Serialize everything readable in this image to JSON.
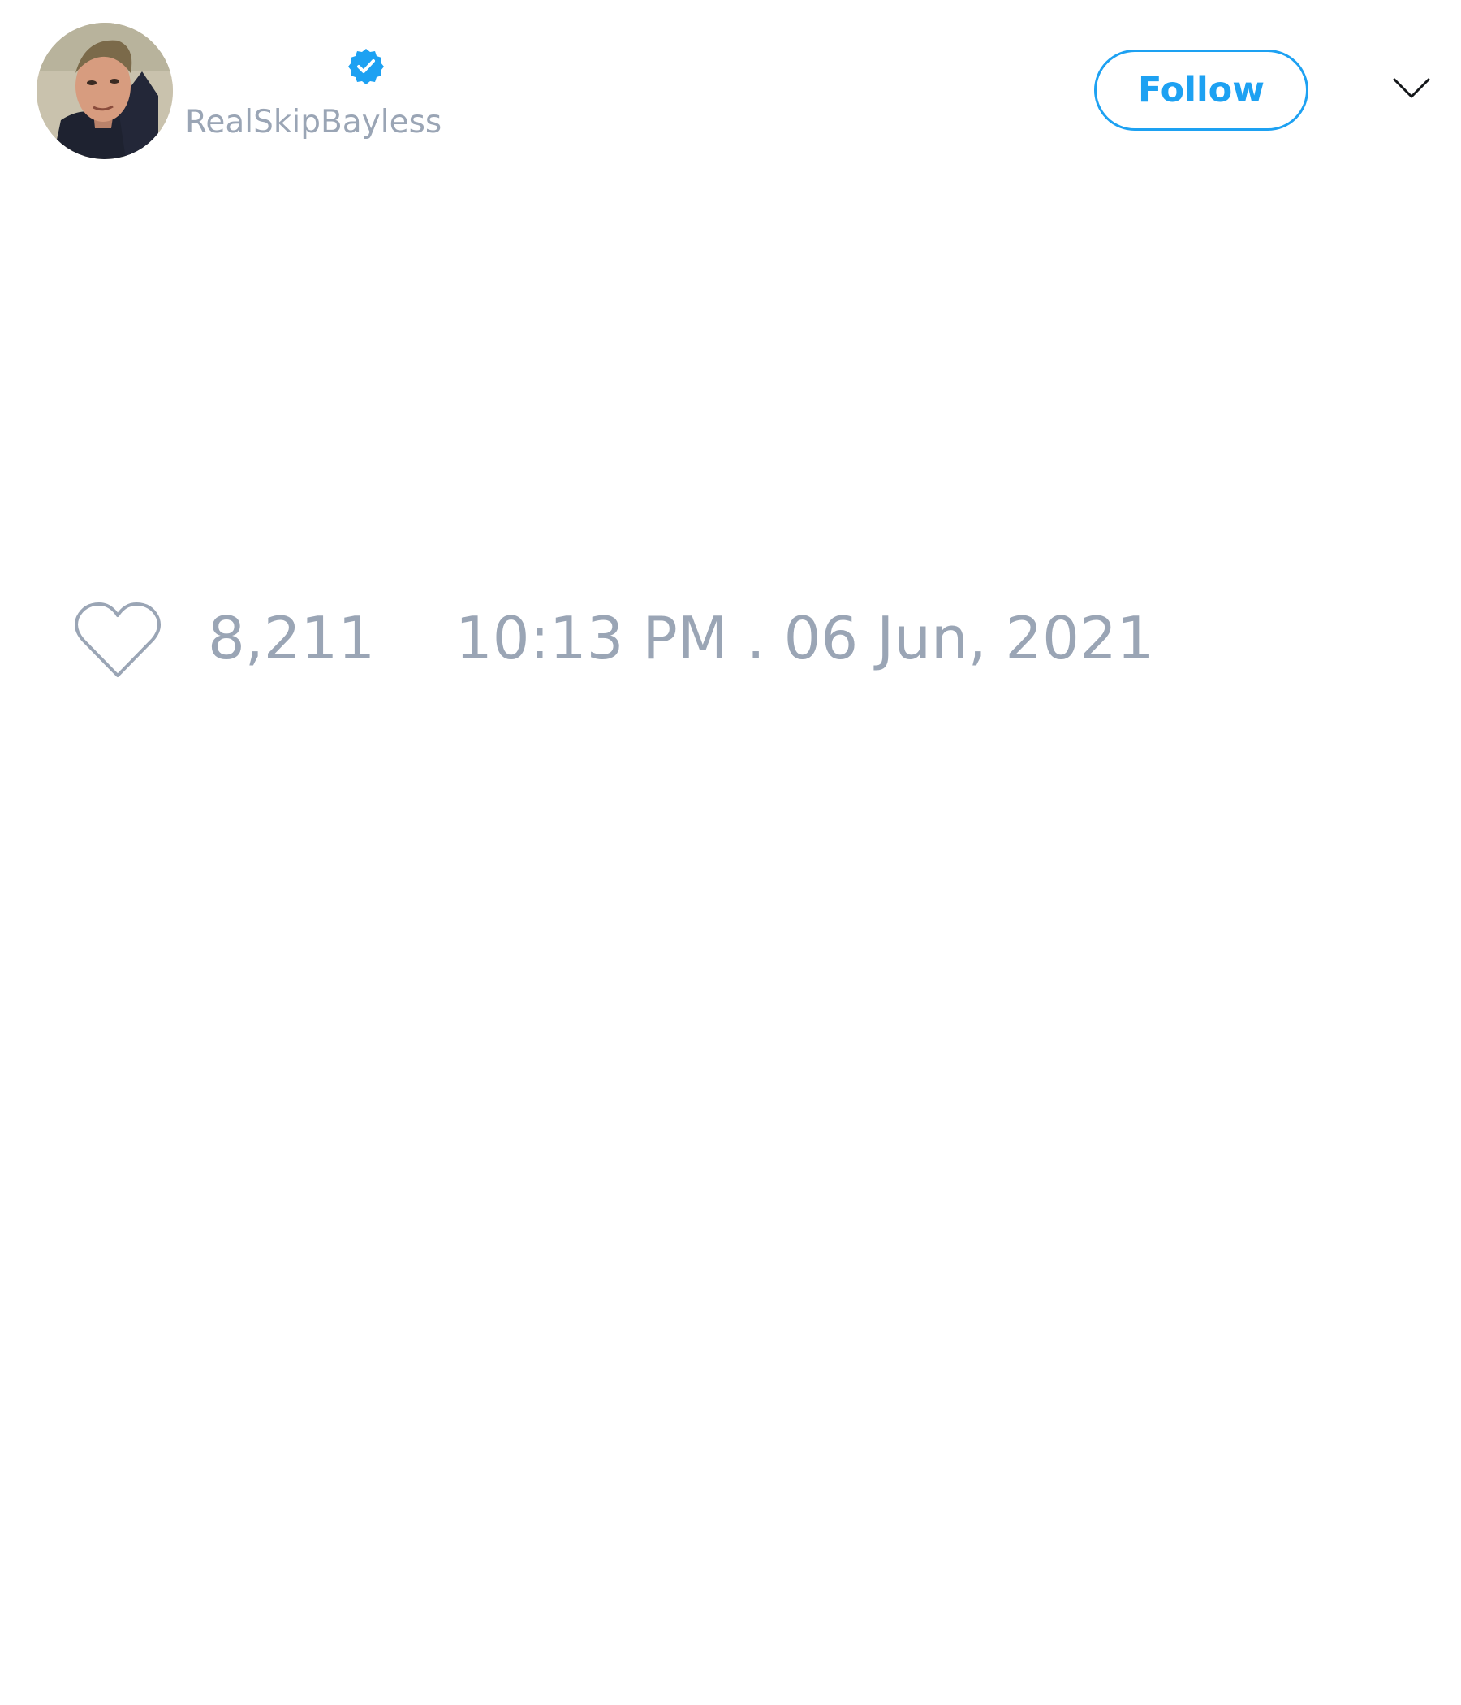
{
  "author": {
    "display_name": "",
    "handle": "RealSkipBayless",
    "verified": true,
    "avatar_icon": "profile-photo"
  },
  "actions": {
    "follow_label": "Follow",
    "menu_icon": "chevron-down-icon"
  },
  "stats": {
    "like_icon": "heart-outline-icon",
    "like_count": "8,211",
    "timestamp": "10:13 PM . 06 Jun, 2021"
  },
  "colors": {
    "accent": "#1da1f2",
    "muted_text": "#9aa5b5",
    "background": "#ffffff"
  }
}
